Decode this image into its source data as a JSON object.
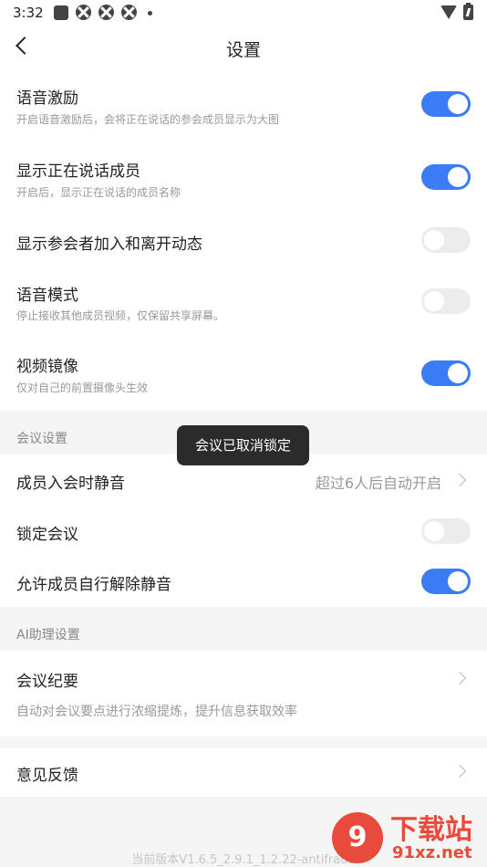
{
  "status_bar": {
    "time": "3:32",
    "icons": [
      "app-square-icon",
      "flower-icon",
      "flower-icon",
      "flower-icon",
      "dot-icon",
      "wifi-icon",
      "battery-icon"
    ]
  },
  "header": {
    "title": "设置",
    "back_icon": "chevron-left-icon"
  },
  "settings": {
    "voice_excitation": {
      "title": "语音激励",
      "desc": "开启语音激励后，会将正在说话的参会成员显示为大图",
      "on": true
    },
    "show_speaking": {
      "title": "显示正在说话成员",
      "desc": "开启后，显示正在说话的成员名称",
      "on": true
    },
    "show_join_leave": {
      "title": "显示参会者加入和离开动态",
      "on": false
    },
    "voice_mode": {
      "title": "语音模式",
      "desc": "停止接收其他成员视频，仅保留共享屏幕。",
      "on": false
    },
    "video_mirror": {
      "title": "视频镜像",
      "desc": "仅对自己的前置摄像头生效",
      "on": true
    }
  },
  "meeting_section": {
    "header": "会议设置",
    "mute_on_join": {
      "title": "成员入会时静音",
      "value": "超过6人后自动开启"
    },
    "lock_meeting": {
      "title": "锁定会议",
      "on": false
    },
    "allow_unmute": {
      "title": "允许成员自行解除静音",
      "on": true
    }
  },
  "ai_section": {
    "header": "AI助理设置",
    "minutes": {
      "title": "会议纪要",
      "desc": "自动对会议要点进行浓缩提炼，提升信息获取效率"
    }
  },
  "feedback": {
    "title": "意见反馈"
  },
  "toast": "会议已取消锁定",
  "version": "当前版本V1.6.5_2.9.1_1.2.22-antifraud",
  "watermark": {
    "logo": "9",
    "title": "下载站",
    "url": "91xz.net"
  },
  "colors": {
    "accent": "#3b7cf4",
    "toggle_off": "#ececec",
    "background": "#f5f5f5",
    "watermark": "#e84a3c"
  }
}
